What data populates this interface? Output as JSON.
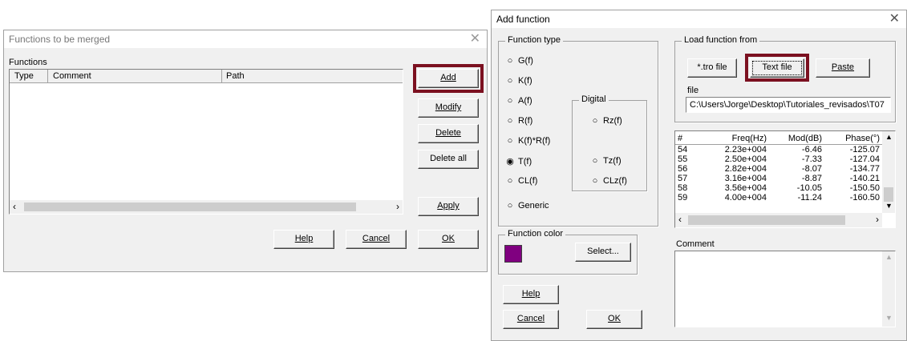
{
  "merge_window": {
    "title": "Functions to be merged",
    "functions_label": "Functions",
    "columns": [
      "Type",
      "Comment",
      "Path"
    ],
    "buttons": {
      "add": "Add",
      "modify": "Modify",
      "delete": "Delete",
      "delete_all": "Delete all",
      "apply": "Apply",
      "help": "Help",
      "cancel": "Cancel",
      "ok": "OK"
    }
  },
  "add_window": {
    "title": "Add function",
    "function_type_label": "Function type",
    "function_types": [
      "G(f)",
      "K(f)",
      "A(f)",
      "R(f)",
      "K(f)*R(f)",
      "T(f)",
      "CL(f)",
      "Generic"
    ],
    "selected_type": "T(f)",
    "digital_label": "Digital",
    "digital_types": [
      "Rz(f)",
      "Tz(f)",
      "CLz(f)"
    ],
    "load_from_label": "Load function from",
    "load_buttons": {
      "tro": "*.tro file",
      "text": "Text file",
      "paste": "Paste"
    },
    "file_label": "file",
    "file_path": "C:\\Users\\Jorge\\Desktop\\Tutoriales_revisados\\T07",
    "table_headers": [
      "#",
      "Freq(Hz)",
      "Mod(dB)",
      "Phase(°)"
    ],
    "table_rows": [
      [
        "54",
        "2.23e+004",
        "-6.46",
        "-125.07"
      ],
      [
        "55",
        "2.50e+004",
        "-7.33",
        "-127.04"
      ],
      [
        "56",
        "2.82e+004",
        "-8.07",
        "-134.77"
      ],
      [
        "57",
        "3.16e+004",
        "-8.87",
        "-140.21"
      ],
      [
        "58",
        "3.56e+004",
        "-10.05",
        "-150.50"
      ],
      [
        "59",
        "4.00e+004",
        "-11.24",
        "-160.50"
      ]
    ],
    "function_color_label": "Function color",
    "function_color": "#800080",
    "select_button": "Select...",
    "comment_label": "Comment",
    "buttons": {
      "help": "Help",
      "cancel": "Cancel",
      "ok": "OK"
    }
  },
  "highlight_color": "#7b1020"
}
